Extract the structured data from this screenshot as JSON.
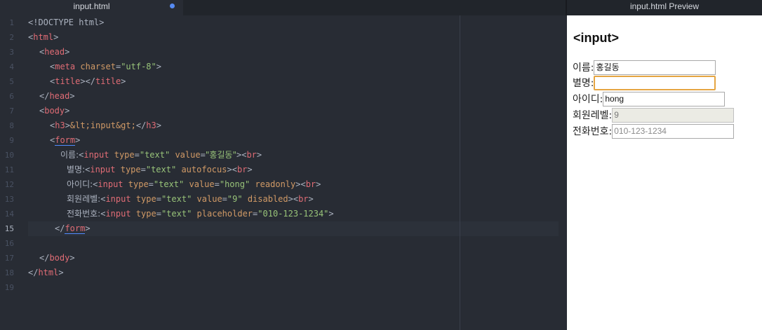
{
  "editor": {
    "tab_title": "input.html",
    "line_numbers": [
      "1",
      "2",
      "3",
      "4",
      "5",
      "6",
      "7",
      "8",
      "9",
      "10",
      "11",
      "12",
      "13",
      "14",
      "15",
      "16",
      "17",
      "18",
      "19"
    ],
    "active_line": "15",
    "code": {
      "doctype": "<!DOCTYPE html>",
      "html": "html",
      "head": "head",
      "meta": "meta",
      "charset_attr": "charset",
      "charset_val": "\"utf-8\"",
      "title": "title",
      "body": "body",
      "h3": "h3",
      "h3_text": "&lt;input&gt;",
      "form": "form",
      "input": "input",
      "type_attr": "type",
      "value_attr": "value",
      "autofocus_attr": "autofocus",
      "readonly_attr": "readonly",
      "disabled_attr": "disabled",
      "placeholder_attr": "placeholder",
      "text_val": "\"text\"",
      "name_val": "\"홍길동\"",
      "hong_val": "\"hong\"",
      "nine_val": "\"9\"",
      "phone_val": "\"010-123-1234\"",
      "br": "br",
      "lbl_name": "이름:",
      "lbl_alias": "별명:",
      "lbl_id": "아이디:",
      "lbl_level": "회원레벨:",
      "lbl_phone": "전화번호:"
    }
  },
  "preview": {
    "tab_title": "input.html Preview",
    "heading": "<input>",
    "fields": [
      {
        "label": "이름:",
        "value": "홍길동",
        "placeholder": ""
      },
      {
        "label": "별명:",
        "value": "",
        "placeholder": ""
      },
      {
        "label": "아이디:",
        "value": "hong",
        "placeholder": ""
      },
      {
        "label": "회원레벨:",
        "value": "9",
        "placeholder": ""
      },
      {
        "label": "전화번호:",
        "value": "",
        "placeholder": "010-123-1234"
      }
    ]
  },
  "colors": {
    "editor_bg": "#282c34",
    "tag": "#e06c75",
    "attribute": "#d19a66",
    "string": "#98c379",
    "modified_dot": "#568af2",
    "focus_ring": "#e5a542"
  }
}
